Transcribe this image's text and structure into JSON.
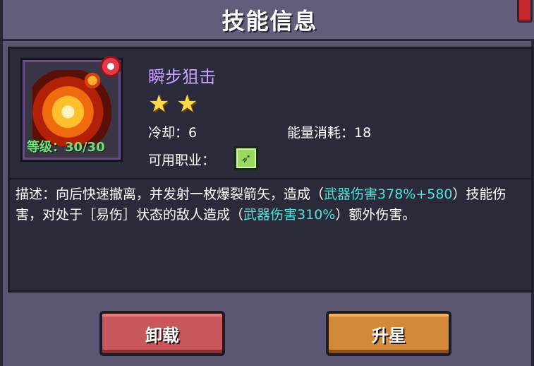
{
  "dialog": {
    "title": "技能信息"
  },
  "skill": {
    "name": "瞬步狙击",
    "level_label": "等级：30/30",
    "star_count": 2,
    "stars": [
      "★",
      "★"
    ],
    "cooldown_label": "冷却：6",
    "energy_label": "能量消耗：18",
    "jobs_label": "可用职业：",
    "job_icon": "bow-icon",
    "rarity_icon": "red-gem-icon"
  },
  "description": {
    "part1": "描述：向后快速撤离，并发射一枚爆裂箭矢，造成（",
    "hl1": "武器伤害378%+580",
    "part2": "）技能伤害，对处于［易伤］状态的敌人造成（",
    "hl2": "武器伤害310%",
    "part3": "）额外伤害。"
  },
  "buttons": {
    "unequip": "卸载",
    "star_up": "升星"
  },
  "colors": {
    "highlight": "#4fe3d9",
    "skill_name": "#c7a3ff",
    "level": "#6fe07a",
    "unequip_button": "#c9565a",
    "star_up_button": "#d28a3a"
  }
}
